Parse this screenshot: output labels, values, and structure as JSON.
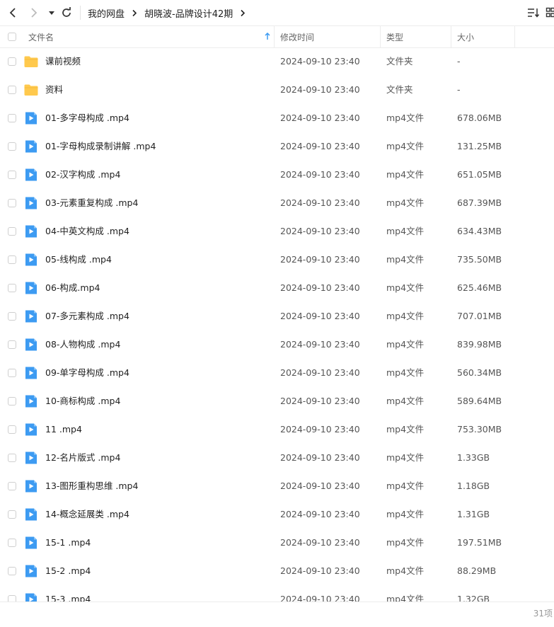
{
  "breadcrumb": [
    "我的网盘",
    "胡晓波-品牌设计42期"
  ],
  "columns": {
    "name": "文件名",
    "modified": "修改时间",
    "type": "类型",
    "size": "大小"
  },
  "files": [
    {
      "name": "课前视频",
      "date": "2024-09-10 23:40",
      "type": "文件夹",
      "size": "-",
      "kind": "folder"
    },
    {
      "name": "资料",
      "date": "2024-09-10 23:40",
      "type": "文件夹",
      "size": "-",
      "kind": "folder"
    },
    {
      "name": "01-多字母构成 .mp4",
      "date": "2024-09-10 23:40",
      "type": "mp4文件",
      "size": "678.06MB",
      "kind": "video"
    },
    {
      "name": "01-字母构成录制讲解 .mp4",
      "date": "2024-09-10 23:40",
      "type": "mp4文件",
      "size": "131.25MB",
      "kind": "video"
    },
    {
      "name": "02-汉字构成 .mp4",
      "date": "2024-09-10 23:40",
      "type": "mp4文件",
      "size": "651.05MB",
      "kind": "video"
    },
    {
      "name": "03-元素重复构成 .mp4",
      "date": "2024-09-10 23:40",
      "type": "mp4文件",
      "size": "687.39MB",
      "kind": "video"
    },
    {
      "name": "04-中英文构成 .mp4",
      "date": "2024-09-10 23:40",
      "type": "mp4文件",
      "size": "634.43MB",
      "kind": "video"
    },
    {
      "name": "05-线构成 .mp4",
      "date": "2024-09-10 23:40",
      "type": "mp4文件",
      "size": "735.50MB",
      "kind": "video"
    },
    {
      "name": "06-构成.mp4",
      "date": "2024-09-10 23:40",
      "type": "mp4文件",
      "size": "625.46MB",
      "kind": "video"
    },
    {
      "name": "07-多元素构成 .mp4",
      "date": "2024-09-10 23:40",
      "type": "mp4文件",
      "size": "707.01MB",
      "kind": "video"
    },
    {
      "name": "08-人物构成 .mp4",
      "date": "2024-09-10 23:40",
      "type": "mp4文件",
      "size": "839.98MB",
      "kind": "video"
    },
    {
      "name": "09-单字母构成 .mp4",
      "date": "2024-09-10 23:40",
      "type": "mp4文件",
      "size": "560.34MB",
      "kind": "video"
    },
    {
      "name": "10-商标构成 .mp4",
      "date": "2024-09-10 23:40",
      "type": "mp4文件",
      "size": "589.64MB",
      "kind": "video"
    },
    {
      "name": "11 .mp4",
      "date": "2024-09-10 23:40",
      "type": "mp4文件",
      "size": "753.30MB",
      "kind": "video"
    },
    {
      "name": "12-名片版式 .mp4",
      "date": "2024-09-10 23:40",
      "type": "mp4文件",
      "size": "1.33GB",
      "kind": "video"
    },
    {
      "name": "13-图形重构思维 .mp4",
      "date": "2024-09-10 23:40",
      "type": "mp4文件",
      "size": "1.18GB",
      "kind": "video"
    },
    {
      "name": "14-概念延展类 .mp4",
      "date": "2024-09-10 23:40",
      "type": "mp4文件",
      "size": "1.31GB",
      "kind": "video"
    },
    {
      "name": "15-1 .mp4",
      "date": "2024-09-10 23:40",
      "type": "mp4文件",
      "size": "197.51MB",
      "kind": "video"
    },
    {
      "name": "15-2 .mp4",
      "date": "2024-09-10 23:40",
      "type": "mp4文件",
      "size": "88.29MB",
      "kind": "video"
    },
    {
      "name": "15-3 .mp4",
      "date": "2024-09-10 23:40",
      "type": "mp4文件",
      "size": "1.32GB",
      "kind": "video"
    }
  ],
  "footer": {
    "count": "31项"
  },
  "colors": {
    "folder": "#ffc94d",
    "video": "#3d9bf2",
    "accent": "#3d9bf2"
  },
  "icons": {
    "back": "chevron-left-icon",
    "forward": "chevron-right-icon",
    "history": "caret-down-icon",
    "refresh": "refresh-icon",
    "sort": "sort-icon",
    "view": "grid-view-icon",
    "sort_asc": "arrow-up-icon"
  }
}
